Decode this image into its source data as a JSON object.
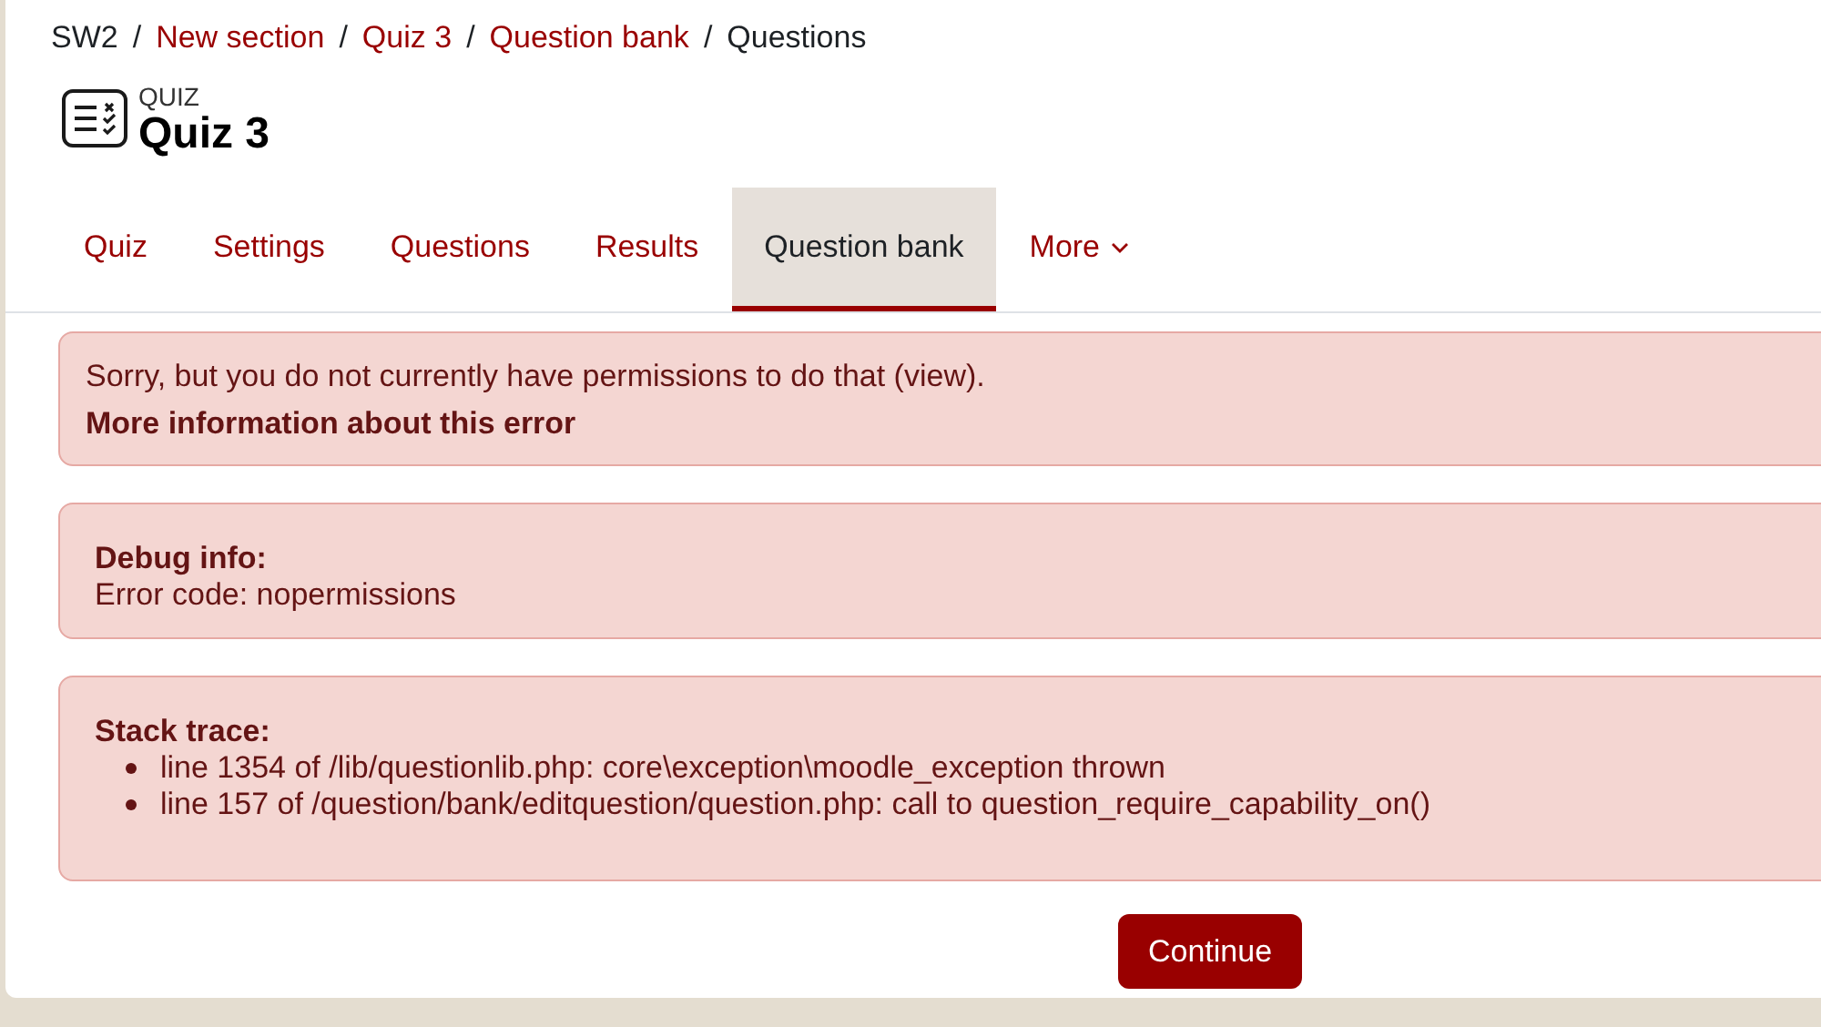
{
  "breadcrumb": [
    {
      "label": "SW2",
      "link": false
    },
    {
      "separator": "/",
      "label": "New section",
      "link": true
    },
    {
      "separator": "/",
      "label": "Quiz 3",
      "link": true
    },
    {
      "separator": "/",
      "label": "Question bank",
      "link": true
    },
    {
      "separator": "/",
      "label": "Questions",
      "link": false
    }
  ],
  "header": {
    "kind_label": "QUIZ",
    "title": "Quiz 3"
  },
  "tabs": [
    {
      "label": "Quiz",
      "selected": false
    },
    {
      "label": "Settings",
      "selected": false
    },
    {
      "label": "Questions",
      "selected": false
    },
    {
      "label": "Results",
      "selected": false
    },
    {
      "label": "Question bank",
      "selected": true
    },
    {
      "label": "More",
      "selected": false,
      "dropdown": true
    }
  ],
  "error": {
    "message": "Sorry, but you do not currently have permissions to do that (view).",
    "more_link": "More information about this error"
  },
  "debug": {
    "heading": "Debug info:",
    "text": "Error code: nopermissions"
  },
  "stack": {
    "heading": "Stack trace:",
    "lines": [
      "line 1354 of /lib/questionlib.php: core\\exception\\moodle_exception thrown",
      "line 157 of /question/bank/editquestion/question.php: call to question_require_capability_on()"
    ]
  },
  "continue_button": "Continue"
}
